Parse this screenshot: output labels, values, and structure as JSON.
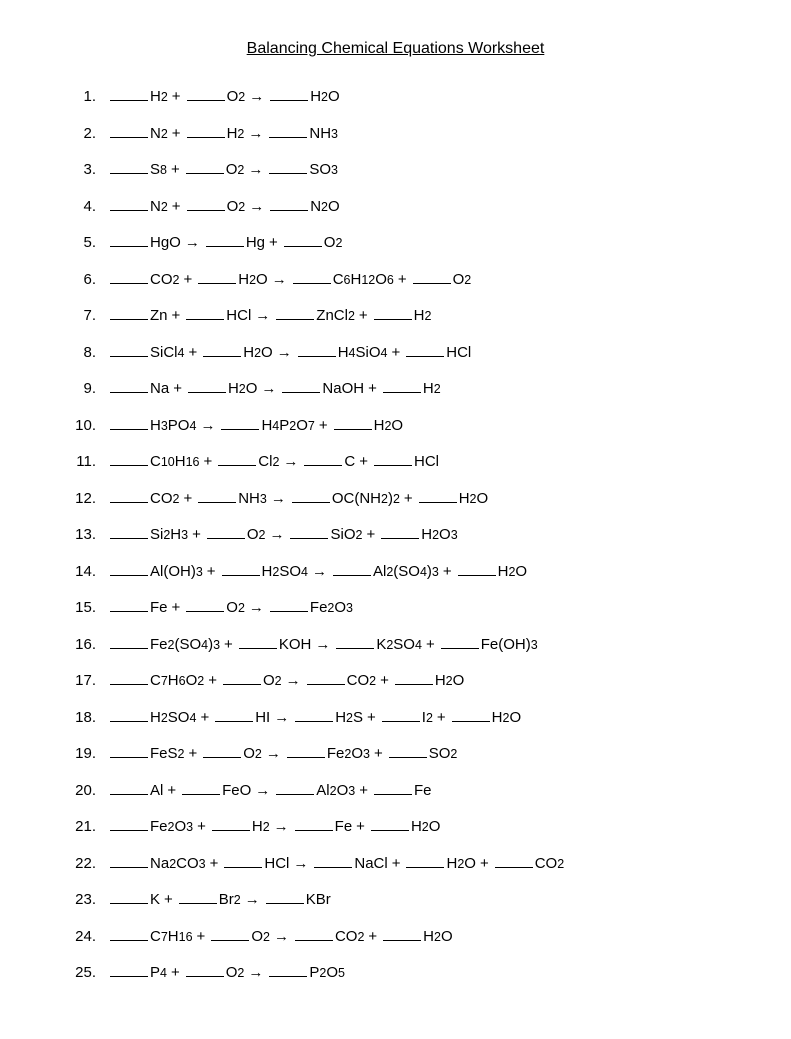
{
  "title": "Balancing Chemical Equations Worksheet",
  "equations": [
    {
      "num": "1.",
      "html": "<span class='blank'></span> H<sub>2</sub> <span class='op'>+</span> <span class='blank'></span> O<sub>2</sub> <span class='arrow'>→</span> <span class='blank'></span> H<sub>2</sub>O"
    },
    {
      "num": "2.",
      "html": "<span class='blank'></span> N<sub>2</sub> <span class='op'>+</span> <span class='blank'></span> H<sub>2</sub> <span class='arrow'>→</span> <span class='blank'></span> NH<sub>3</sub>"
    },
    {
      "num": "3.",
      "html": "<span class='blank'></span> S<sub>8</sub> <span class='op'>+</span> <span class='blank'></span> O<sub>2</sub> <span class='arrow'>→</span> <span class='blank'></span> SO<sub>3</sub>"
    },
    {
      "num": "4.",
      "html": "<span class='blank'></span> N<sub>2</sub> <span class='op'>+</span> <span class='blank'></span> O<sub>2</sub> <span class='arrow'>→</span> <span class='blank'></span> N<sub>2</sub>O"
    },
    {
      "num": "5.",
      "html": "<span class='blank'></span> HgO <span class='arrow'>→</span> <span class='blank'></span> Hg <span class='op'>+</span> <span class='blank'></span> O<sub>2</sub>"
    },
    {
      "num": "6.",
      "html": "<span class='blank'></span> CO<sub>2</sub> <span class='op'>+</span> <span class='blank'></span> H<sub>2</sub>O <span class='arrow'>→</span> <span class='blank'></span> C<sub>6</sub>H<sub>12</sub>O<sub>6</sub> <span class='op'>+</span> <span class='blank'></span> O<sub>2</sub>"
    },
    {
      "num": "7.",
      "html": "<span class='blank'></span> Zn <span class='op'>+</span> <span class='blank'></span> HCl <span class='arrow'>→</span> <span class='blank'></span> ZnCl<sub>2</sub> <span class='op'>+</span> <span class='blank'></span> H<sub>2</sub>"
    },
    {
      "num": "8.",
      "html": "<span class='blank'></span> SiCl<sub>4</sub> <span class='op'>+</span> <span class='blank'></span> H<sub>2</sub>O <span class='arrow'>→</span> <span class='blank'></span> H<sub>4</sub>SiO<sub>4</sub> <span class='op'>+</span> <span class='blank'></span> HCl"
    },
    {
      "num": "9.",
      "html": "<span class='blank'></span> Na <span class='op'>+</span> <span class='blank'></span> H<sub>2</sub>O <span class='arrow'>→</span> <span class='blank'></span> NaOH <span class='op'>+</span> <span class='blank'></span> H<sub>2</sub>"
    },
    {
      "num": "10.",
      "html": "<span class='blank'></span> H<sub>3</sub>PO<sub>4</sub> <span class='arrow'>→</span> <span class='blank'></span> H<sub>4</sub>P<sub>2</sub>O<sub>7</sub> <span class='op'>+</span> <span class='blank'></span> H<sub>2</sub>O"
    },
    {
      "num": "11.",
      "html": "<span class='blank'></span> C<sub>10</sub>H<sub>16</sub> <span class='op'>+</span> <span class='blank'></span> Cl<sub>2</sub> <span class='arrow'>→</span> <span class='blank'></span> C <span class='op'>+</span> <span class='blank'></span> HCl"
    },
    {
      "num": "12.",
      "html": "<span class='blank'></span> CO<sub>2</sub> <span class='op'>+</span> <span class='blank'></span> NH<sub>3</sub> <span class='arrow'>→</span> <span class='blank'></span> OC(NH<sub>2</sub>)<sub>2</sub> <span class='op'>+</span> <span class='blank'></span> H<sub>2</sub>O"
    },
    {
      "num": "13.",
      "html": "<span class='blank'></span> Si<sub>2</sub>H<sub>3</sub> <span class='op'>+</span> <span class='blank'></span> O<sub>2</sub> <span class='arrow'>→</span> <span class='blank'></span> SiO<sub>2</sub> <span class='op'>+</span> <span class='blank'></span> H<sub>2</sub>O<sub>3</sub>"
    },
    {
      "num": "14.",
      "html": "<span class='blank'></span> Al(OH)<sub>3</sub> <span class='op'>+</span> <span class='blank'></span> H<sub>2</sub>SO<sub>4</sub> <span class='arrow'>→</span> <span class='blank'></span> Al<sub>2</sub>(SO<sub>4</sub>)<sub>3</sub> <span class='op'>+</span> <span class='blank'></span> H<sub>2</sub>O"
    },
    {
      "num": "15.",
      "html": "<span class='blank'></span> Fe <span class='op'>+</span> <span class='blank'></span> O<sub>2</sub> <span class='arrow'>→</span> <span class='blank'></span> Fe<sub>2</sub>O<sub>3</sub>"
    },
    {
      "num": "16.",
      "html": "<span class='blank'></span> Fe<sub>2</sub>(SO<sub>4</sub>)<sub>3</sub> <span class='op'>+</span> <span class='blank'></span> KOH <span class='arrow'>→</span> <span class='blank'></span> K<sub>2</sub>SO<sub>4</sub> <span class='op'>+</span> <span class='blank'></span> Fe(OH)<sub>3</sub>"
    },
    {
      "num": "17.",
      "html": "<span class='blank'></span> C<sub>7</sub>H<sub>6</sub>O<sub>2</sub> <span class='op'>+</span> <span class='blank'></span> O<sub>2</sub> <span class='arrow'>→</span> <span class='blank'></span> CO<sub>2</sub> <span class='op'>+</span> <span class='blank'></span> H<sub>2</sub>O"
    },
    {
      "num": "18.",
      "html": "<span class='blank'></span> H<sub>2</sub>SO<sub>4</sub> <span class='op'>+</span> <span class='blank'></span> HI <span class='arrow'>→</span> <span class='blank'></span> H<sub>2</sub>S <span class='op'>+</span> <span class='blank'></span> I<sub>2</sub> <span class='op'>+</span> <span class='blank'></span> H<sub>2</sub>O"
    },
    {
      "num": "19.",
      "html": "<span class='blank'></span> FeS<sub>2</sub> <span class='op'>+</span> <span class='blank'></span> O<sub>2</sub> <span class='arrow'>→</span> <span class='blank'></span> Fe<sub>2</sub>O<sub>3</sub> <span class='op'>+</span> <span class='blank'></span> SO<sub>2</sub>"
    },
    {
      "num": "20.",
      "html": "<span class='blank'></span> Al <span class='op'>+</span> <span class='blank'></span> FeO <span class='arrow'>→</span> <span class='blank'></span> Al<sub>2</sub>O<sub>3</sub> <span class='op'>+</span> <span class='blank'></span> Fe"
    },
    {
      "num": "21.",
      "html": "<span class='blank'></span> Fe<sub>2</sub>O<sub>3</sub> <span class='op'>+</span> <span class='blank'></span> H<sub>2</sub> <span class='arrow'>→</span> <span class='blank'></span> Fe <span class='op'>+</span> <span class='blank'></span> H<sub>2</sub>O"
    },
    {
      "num": "22.",
      "html": "<span class='blank'></span> Na<sub>2</sub>CO<sub>3</sub> <span class='op'>+</span> <span class='blank'></span> HCl <span class='arrow'>→</span> <span class='blank'></span> NaCl <span class='op'>+</span> <span class='blank'></span> H<sub>2</sub>O <span class='op'>+</span> <span class='blank'></span> CO<sub>2</sub>"
    },
    {
      "num": "23.",
      "html": "<span class='blank'></span> K <span class='op'>+</span> <span class='blank'></span> Br<sub>2</sub> <span class='arrow'>→</span> <span class='blank'></span> KBr"
    },
    {
      "num": "24.",
      "html": "<span class='blank'></span> C<sub>7</sub>H<sub>16</sub> <span class='op'>+</span> <span class='blank'></span> O<sub>2</sub> <span class='arrow'>→</span> <span class='blank'></span> CO<sub>2</sub> <span class='op'>+</span> <span class='blank'></span> H<sub>2</sub>O"
    },
    {
      "num": "25.",
      "html": "<span class='blank'></span> P<sub>4</sub> <span class='op'>+</span> <span class='blank'></span> O<sub>2</sub> <span class='arrow'>→</span> <span class='blank'></span> P<sub>2</sub>O<sub>5</sub>"
    }
  ]
}
